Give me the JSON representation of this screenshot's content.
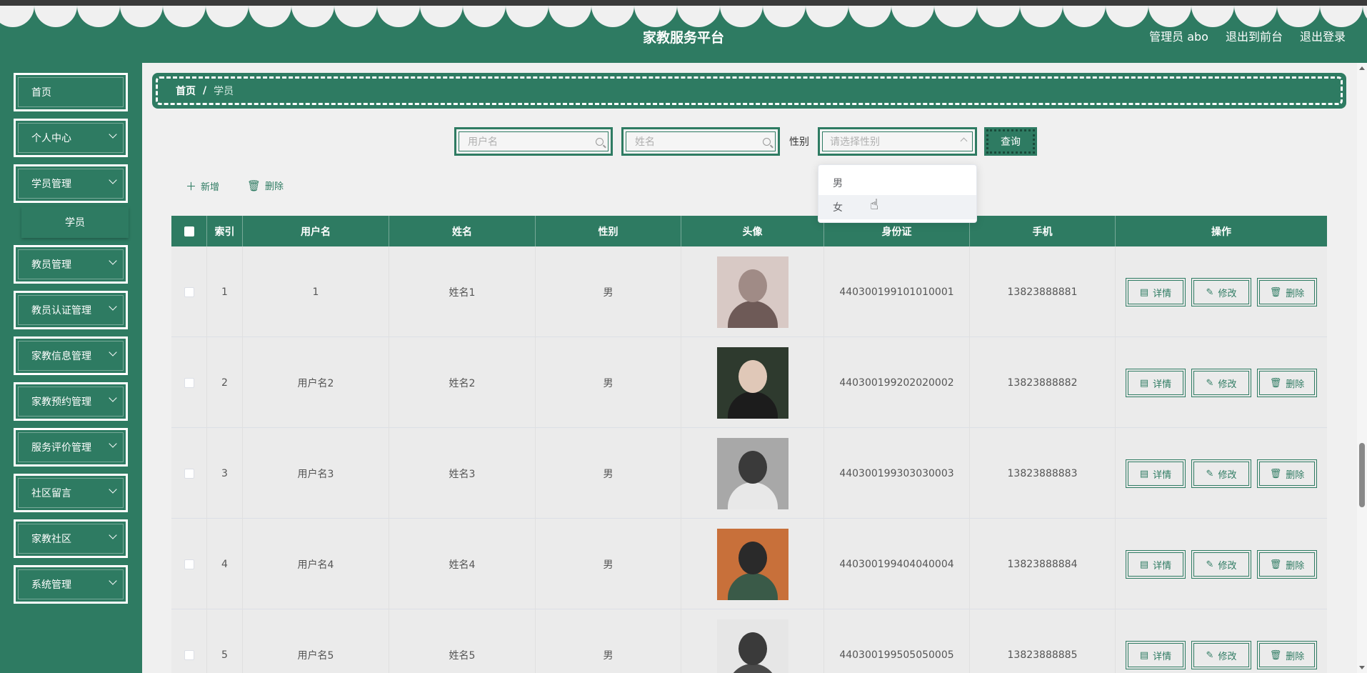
{
  "header": {
    "title": "家教服务平台",
    "admin_label": "管理员 abo",
    "front_label": "退出到前台",
    "logout_label": "退出登录"
  },
  "sidebar": {
    "items": [
      {
        "label": "首页"
      },
      {
        "label": "个人中心"
      },
      {
        "label": "学员管理"
      },
      {
        "label": "教员管理"
      },
      {
        "label": "教员认证管理"
      },
      {
        "label": "家教信息管理"
      },
      {
        "label": "家教预约管理"
      },
      {
        "label": "服务评价管理"
      },
      {
        "label": "社区留言"
      },
      {
        "label": "家教社区"
      },
      {
        "label": "系统管理"
      }
    ],
    "sub_item": "学员"
  },
  "breadcrumb": {
    "home": "首页",
    "separator": "/",
    "current": "学员"
  },
  "search": {
    "username_placeholder": "用户名",
    "name_placeholder": "姓名",
    "gender_label": "性别",
    "gender_placeholder": "请选择性别",
    "query_label": "查询",
    "gender_options": [
      "男",
      "女"
    ]
  },
  "toolbar": {
    "add_label": "新增",
    "delete_label": "删除"
  },
  "table": {
    "columns": [
      "索引",
      "用户名",
      "姓名",
      "性别",
      "头像",
      "身份证",
      "手机",
      "操作"
    ],
    "actions": {
      "detail": "详情",
      "edit": "修改",
      "delete": "删除"
    },
    "rows": [
      {
        "index": "1",
        "username": "1",
        "name": "姓名1",
        "gender": "男",
        "idcard": "440300199101010001",
        "phone": "13823888881"
      },
      {
        "index": "2",
        "username": "用户名2",
        "name": "姓名2",
        "gender": "男",
        "idcard": "440300199202020002",
        "phone": "13823888882"
      },
      {
        "index": "3",
        "username": "用户名3",
        "name": "姓名3",
        "gender": "男",
        "idcard": "440300199303030003",
        "phone": "13823888883"
      },
      {
        "index": "4",
        "username": "用户名4",
        "name": "姓名4",
        "gender": "男",
        "idcard": "440300199404040004",
        "phone": "13823888884"
      },
      {
        "index": "5",
        "username": "用户名5",
        "name": "姓名5",
        "gender": "男",
        "idcard": "440300199505050005",
        "phone": "13823888885"
      }
    ]
  },
  "colors": {
    "primary": "#2e7b62",
    "background": "#f0f0f0"
  }
}
